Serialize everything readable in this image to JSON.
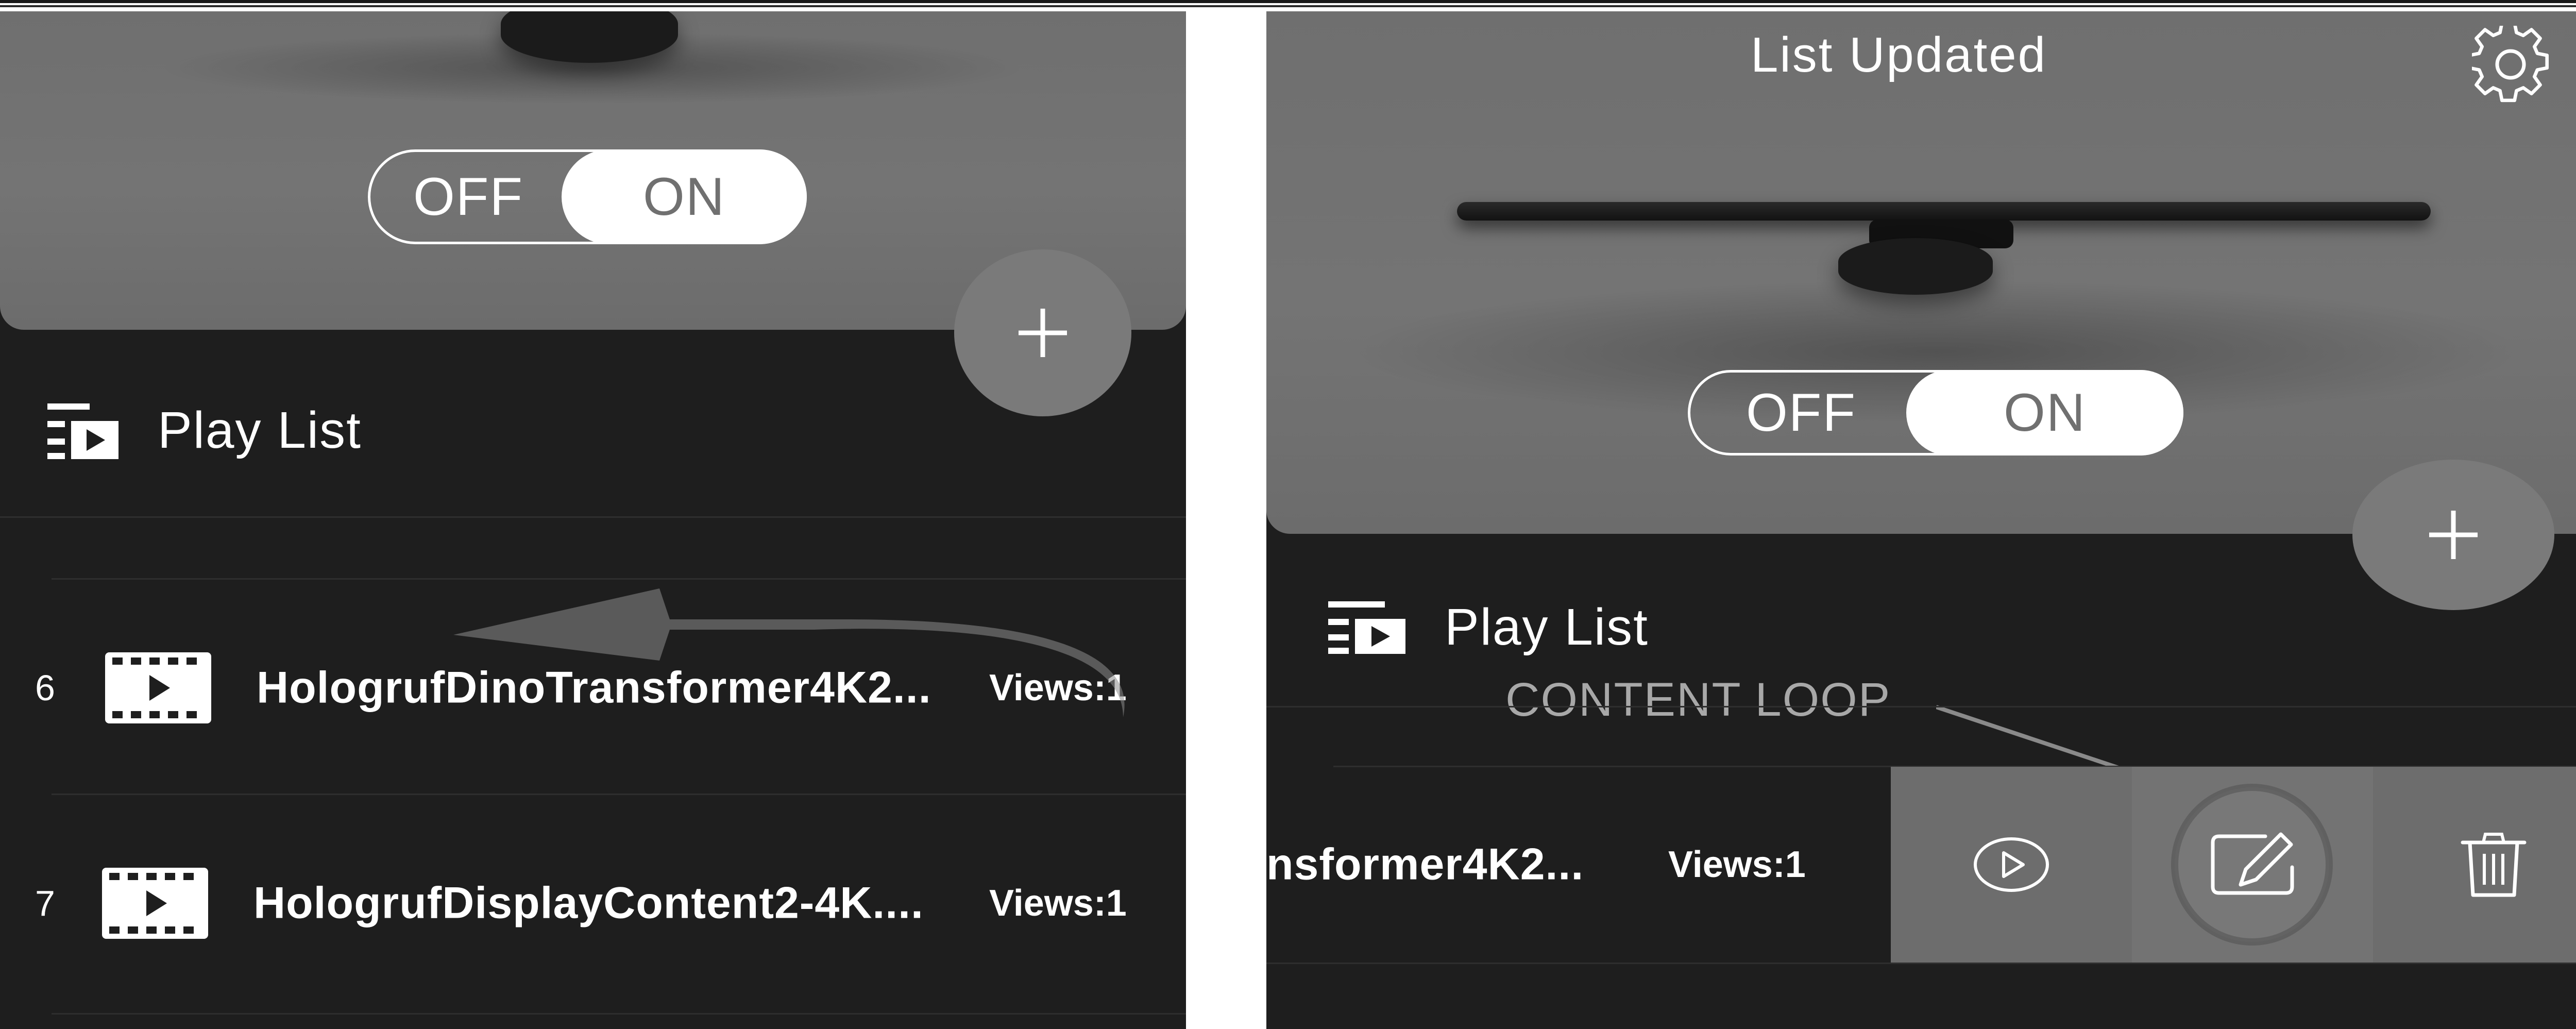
{
  "left_panel": {
    "toggle": {
      "off_label": "OFF",
      "on_label": "ON",
      "state": "on"
    },
    "add_button_label": "+",
    "playlist_header": "Play List",
    "rows": [
      {
        "index": "6",
        "name": "HologrufDinoTransformer4K2...",
        "views": "Views:1"
      },
      {
        "index": "7",
        "name": "HologrufDisplayContent2-4K....",
        "views": "Views:1"
      }
    ]
  },
  "right_panel": {
    "title": "List Updated",
    "toggle": {
      "off_label": "OFF",
      "on_label": "ON",
      "state": "on"
    },
    "add_button_label": "+",
    "playlist_header": "Play List",
    "callout": "CONTENT LOOP",
    "swiped_row": {
      "name": "nsformer4K2...",
      "views": "Views:1"
    },
    "actions": [
      {
        "icon": "play-circle-icon"
      },
      {
        "icon": "edit-icon"
      },
      {
        "icon": "trash-icon"
      }
    ]
  },
  "colors": {
    "panel_bg": "#1e1e1e",
    "hero_bg": "#727272",
    "fab_bg": "#7a7a7a",
    "action_bg": "#6e6e6e",
    "text": "#ffffff",
    "callout": "#a8a8a8"
  }
}
